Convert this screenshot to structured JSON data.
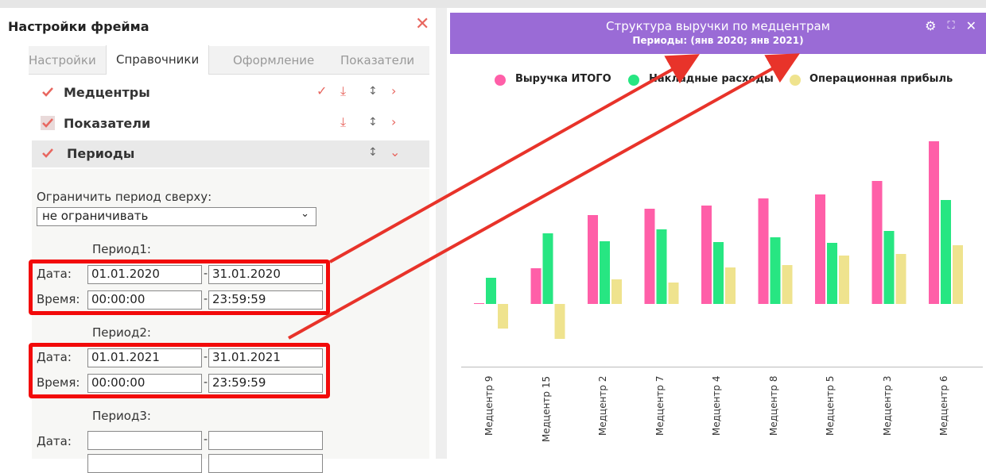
{
  "left_panel": {
    "title": "Настройки фрейма",
    "tabs": [
      "Настройки",
      "Справочники",
      "Оформление",
      "Показатели"
    ],
    "sections": [
      {
        "label": "Медцентры"
      },
      {
        "label": "Показатели"
      },
      {
        "label": "Периоды"
      }
    ],
    "limit_label": "Ограничить период сверху:",
    "limit_value": "не ограничивать",
    "periods": [
      {
        "title": "Период1:",
        "date_label": "Дата:",
        "time_label": "Время:",
        "date_from": "01.01.2020",
        "date_to": "31.01.2020",
        "time_from": "00:00:00",
        "time_to": "23:59:59"
      },
      {
        "title": "Период2:",
        "date_label": "Дата:",
        "time_label": "Время:",
        "date_from": "01.01.2021",
        "date_to": "31.01.2021",
        "time_from": "00:00:00",
        "time_to": "23:59:59"
      },
      {
        "title": "Период3:",
        "date_label": "Дата:",
        "time_label": "Время:",
        "date_from": "",
        "date_to": "",
        "time_from": "",
        "time_to": ""
      }
    ],
    "dash": "-"
  },
  "right_panel": {
    "title": "Структура выручки по медцентрам",
    "subtitle": "Периоды: (янв 2020; янв 2021)",
    "icons": [
      "gear-icon",
      "expand-icon",
      "close-icon"
    ]
  },
  "colors": {
    "accent": "#e8665f",
    "header": "#9a6bd6",
    "highlight": "#f20a0a"
  },
  "chart_data": {
    "type": "bar",
    "categories": [
      "Медцентр 9",
      "Медцентр 15",
      "Медцентр 2",
      "Медцентр 7",
      "Медцентр 4",
      "Медцентр 8",
      "Медцентр 5",
      "Медцентр 3",
      "Медцентр 6"
    ],
    "series": [
      {
        "name": "Выручка ИТОГО",
        "color": "#ff5fa8",
        "values": [
          1,
          45,
          112,
          120,
          124,
          133,
          138,
          155,
          205
        ]
      },
      {
        "name": "Накладные расходы",
        "color": "#27e682",
        "values": [
          33,
          89,
          79,
          94,
          78,
          84,
          77,
          92,
          131
        ]
      },
      {
        "name": "Операционная прибыль",
        "color": "#efe38e",
        "values": [
          -31,
          -44,
          31,
          27,
          46,
          49,
          61,
          63,
          74
        ]
      }
    ],
    "legend": "top",
    "grid": false
  }
}
